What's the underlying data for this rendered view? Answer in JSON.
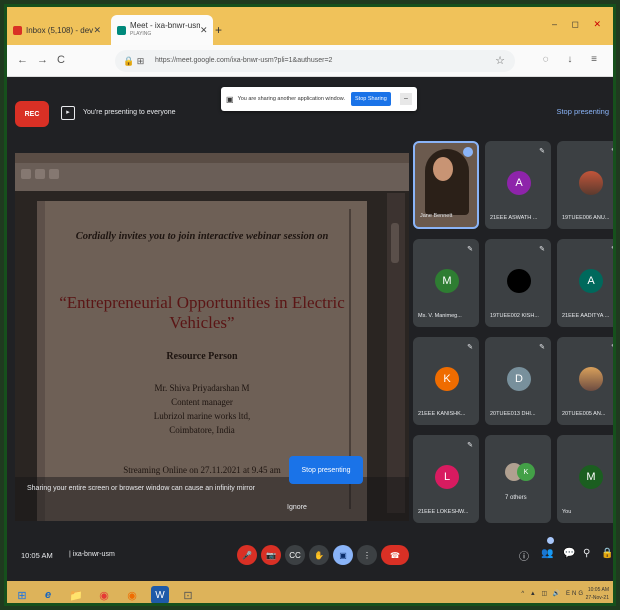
{
  "browser": {
    "tabs": [
      {
        "label": "Inbox (5,108) - devi@edu.in",
        "favicon_color": "#d93025"
      },
      {
        "label": "Meet - ixa-bnwr-usm",
        "sublabel": "PLAYING",
        "favicon_color": "#00897b"
      }
    ],
    "new_tab": "+",
    "window_controls": "– ◻ ✕",
    "url": "https://meet.google.com/ixa-bnwr-usm?pli=1&authuser=2",
    "nav": {
      "back": "←",
      "forward": "→",
      "reload": "C"
    },
    "share_banner": {
      "text": "You are sharing another application window.",
      "stop_label": "Stop Sharing",
      "hide_label": "–"
    }
  },
  "meet": {
    "rec_label": "REC",
    "presenting_text": "You're presenting to everyone",
    "stop_presenting_top": "Stop presenting",
    "shared_doc": {
      "invite": "Cordially invites you to join interactive webinar session on",
      "title": "“Entrepreneurial Opportunities in Electric Vehicles”",
      "resource_label": "Resource Person",
      "speaker_name": "Mr. Shiva Priyadarshan M",
      "speaker_role": "Content manager",
      "speaker_org": "Lubrizol marine works ltd,",
      "speaker_city": "Coimbatore, India",
      "date_line": "Streaming Online on 27.11.2021 at 9.45 am"
    },
    "warning": "Sharing your entire screen or browser window can cause an infinity mirror",
    "stop_presenting_button": "Stop presenting",
    "ignore_label": "Ignore",
    "participants": [
      {
        "name": "Jane Bennett",
        "self": true
      },
      {
        "name": "21EEE ASWATH ...",
        "initial": "A",
        "color": "#8e24aa"
      },
      {
        "name": "19TUEE006 ANU...",
        "initial": "",
        "color": "#6d4c41"
      },
      {
        "name": "Ms. V. Manimeg...",
        "initial": "M",
        "color": "#2e7d32"
      },
      {
        "name": "19TUEE002 KISH...",
        "initial": "",
        "color": "#000000"
      },
      {
        "name": "21EEE AADITYA ...",
        "initial": "A",
        "color": "#00695c"
      },
      {
        "name": "21EEE KANISHK...",
        "initial": "K",
        "color": "#ef6c00"
      },
      {
        "name": "20TUEE013 DHI...",
        "initial": "D",
        "color": "#78909c"
      },
      {
        "name": "20TUEE005 AN...",
        "initial": "",
        "color": "#8d6e63"
      },
      {
        "name": "21EEE LOKESHW...",
        "initial": "L",
        "color": "#d81b60"
      },
      {
        "name": "7 others",
        "initial": "",
        "color": "#3c4043"
      },
      {
        "name": "You",
        "initial": "M",
        "color": "#1b5e20"
      }
    ],
    "others_avatars": [
      "",
      "K"
    ],
    "clock": "10:05 AM",
    "meeting_code": "ixa-bnwr-usm",
    "controls": {
      "mic": "🎤",
      "camera": "📷",
      "captions": "CC",
      "raise_hand": "✋",
      "present": "▣",
      "more": "⋮",
      "end_call": "☎"
    },
    "right_controls": {
      "info": "ⓘ",
      "people": "👥",
      "chat": "💬",
      "activities": "⚲",
      "host": "🔒"
    }
  },
  "taskbar": {
    "start_icon": "⊞",
    "apps": [
      "e",
      "📁",
      "◉",
      "◉",
      "W",
      "⊡"
    ],
    "tray": "^ ▲ ◫ 🔊 ENG",
    "time": "10:05 AM",
    "date": "27-Nov-21"
  }
}
